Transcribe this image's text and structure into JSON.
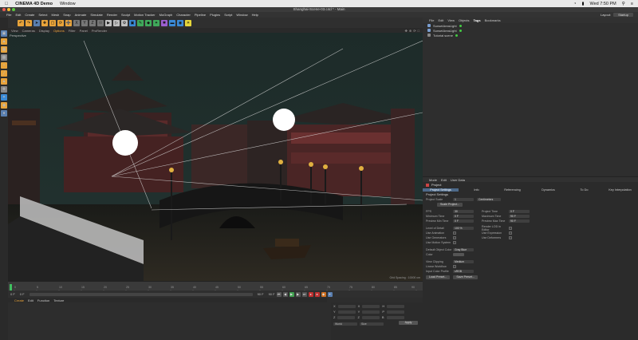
{
  "macbar": {
    "app_name": "CINEMA 4D Demo",
    "menu": [
      "Window"
    ],
    "clock": "Wed 7:50 PM"
  },
  "window": {
    "title": "Shanghai-Scene-03.c4d * - Main"
  },
  "main_menu": [
    "File",
    "Edit",
    "Create",
    "Select",
    "Mesh",
    "Snap",
    "Animate",
    "Simulate",
    "Render",
    "Sculpt",
    "Motion Tracker",
    "MoGraph",
    "Character",
    "Pipeline",
    "Plugins",
    "Script",
    "Window",
    "Help"
  ],
  "layout": {
    "label": "Layout:",
    "value": "Startup"
  },
  "object_manager": {
    "menu": [
      "File",
      "Edit",
      "View",
      "Objects",
      "Tags",
      "Bookmarks"
    ],
    "objects": [
      "SunsetAreaLight",
      "SunsetAreaLight",
      "Tutorial scene"
    ]
  },
  "viewport": {
    "menu": [
      "View",
      "Cameras",
      "Display",
      "Options",
      "Filter",
      "Panel",
      "ProRender"
    ],
    "camera": "Perspective",
    "info": "Grid Spacing : 10000 cm"
  },
  "timeline": {
    "ticks": [
      "0",
      "5",
      "10",
      "15",
      "20",
      "25",
      "30",
      "35",
      "40",
      "45",
      "50",
      "55",
      "60",
      "65",
      "70",
      "75",
      "80",
      "85",
      "90"
    ],
    "current_frame": "0 F",
    "start": "0 F",
    "end": "90 F",
    "end2": "90 F"
  },
  "material_manager": {
    "menu": [
      "Create",
      "Edit",
      "Function",
      "Texture"
    ]
  },
  "coords": {
    "rows": [
      {
        "a": "X",
        "av": "0 cm",
        "b": "X",
        "bv": "0 cm",
        "c": "H",
        "cv": "0 °"
      },
      {
        "a": "Y",
        "av": "0 cm",
        "b": "Y",
        "bv": "0 cm",
        "c": "P",
        "cv": "0 °"
      },
      {
        "a": "Z",
        "av": "0 cm",
        "b": "Z",
        "bv": "0 cm",
        "c": "B",
        "cv": "0 °"
      }
    ],
    "world": "World",
    "scale": "Size",
    "apply": "Apply"
  },
  "attributes": {
    "menu": [
      "Mode",
      "Edit",
      "User Data"
    ],
    "header": "Project",
    "tabs": [
      "Project Settings",
      "Info",
      "Referencing",
      "Dynamics",
      "To Do",
      "Key Interpolation"
    ],
    "section": "Project Settings",
    "scale_label": "Project Scale",
    "scale_value": "1",
    "scale_unit": "Centimeters",
    "scale_button": "Scale Project...",
    "fps_label": "FPS",
    "fps": "30",
    "project_time_label": "Project Time",
    "project_time": "0 F",
    "min_time_label": "Minimum Time",
    "min_time": "0 F",
    "max_time_label": "Maximum Time",
    "max_time": "90 F",
    "prev_min_label": "Preview Min Time",
    "prev_min": "0 F",
    "prev_max_label": "Preview Max Time",
    "prev_max": "90 F",
    "lod_label": "Level of Detail",
    "lod": "100 %",
    "render_lod_label": "Render LOD in Editor",
    "use_anim": "Use Animation",
    "use_expr": "Use Expression",
    "use_gen": "Use Generators",
    "use_def": "Use Deformers",
    "use_motion": "Use Motion System",
    "obj_color_label": "Default Object Color",
    "obj_color": "Gray Blue",
    "color_label": "Color",
    "clipping_label": "View Clipping",
    "clipping": "Medium",
    "linear_label": "Linear Workflow",
    "profile_label": "Input Color Profile",
    "profile": "sRGB",
    "load_preset": "Load Preset...",
    "save_preset": "Save Preset..."
  },
  "colors": {
    "accent": "#e8a33a",
    "tab_selected": "#4d6a8a"
  }
}
